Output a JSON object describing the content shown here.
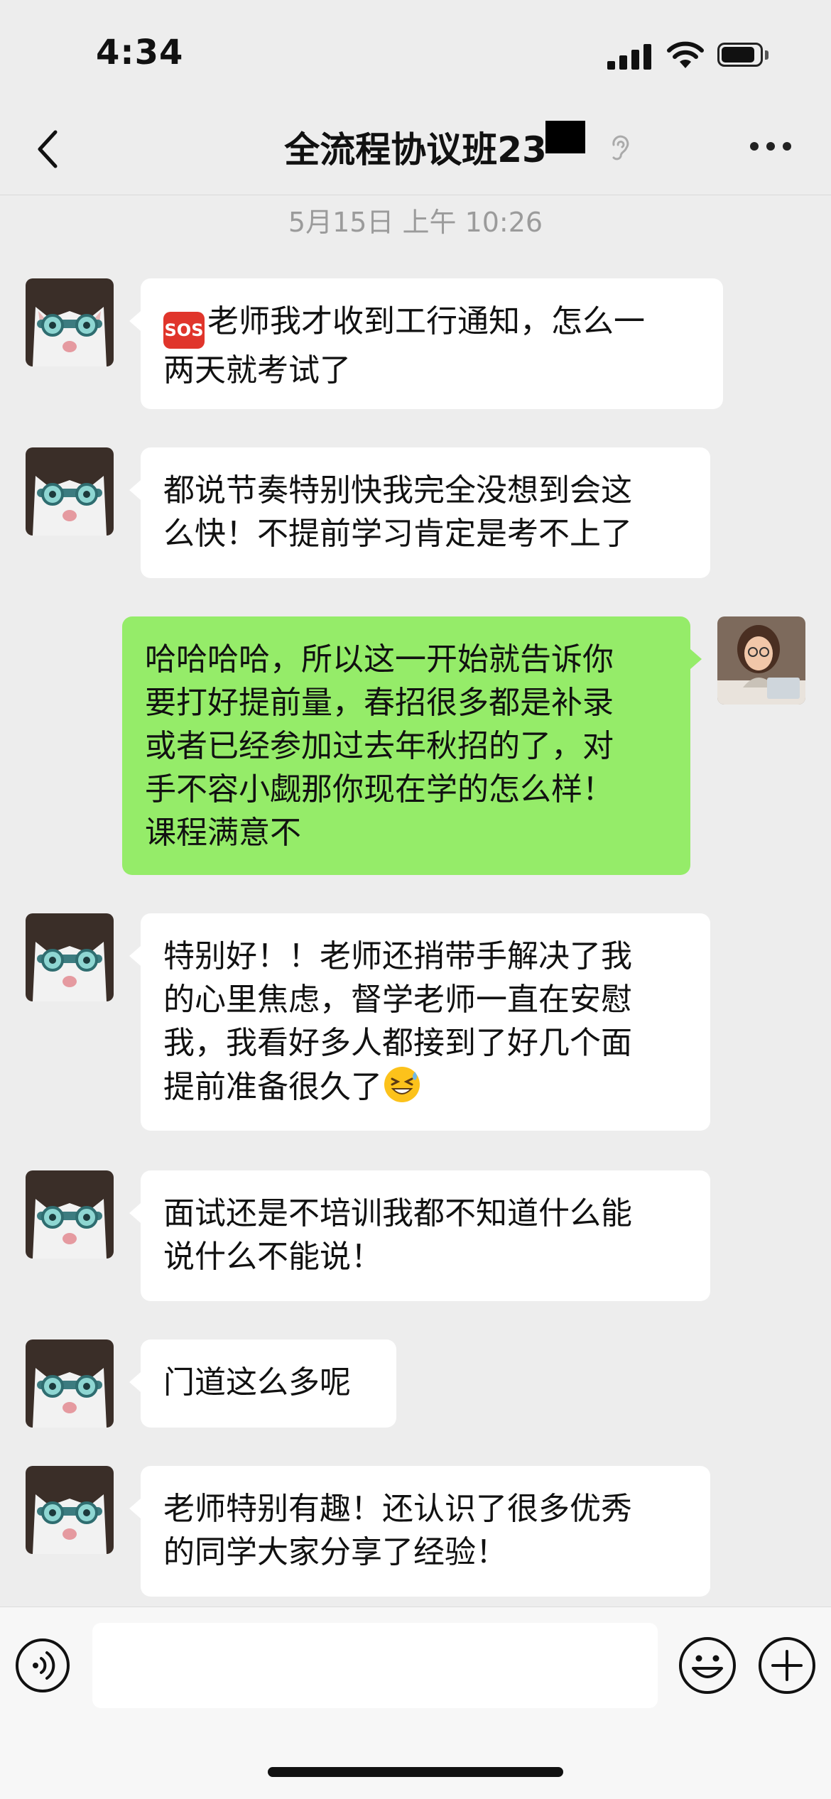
{
  "status_bar": {
    "time": "4:34",
    "icons": [
      "signal-icon",
      "wifi-icon",
      "battery-icon"
    ]
  },
  "nav": {
    "back_icon": "chevron-left-icon",
    "title": "全流程协议班23",
    "mute_icon": "ear-icon",
    "more_icon": "more-dots-icon"
  },
  "chat": {
    "timestamp": "5月15日 上午 10:26",
    "messages": [
      {
        "from": "other",
        "text": "老师我才收到工行通知，怎么一\n两天就考试了",
        "leading_emoji": "sos-emoji",
        "badge_text": "SOS"
      },
      {
        "from": "other",
        "text": "都说节奏特别快我完全没想到会这\n么快！不提前学习肯定是考不上了"
      },
      {
        "from": "me",
        "text": "哈哈哈哈，所以这一开始就告诉你\n要打好提前量，春招很多都是补录\n或者已经参加过去年秋招的了，对\n手不容小觑那你现在学的怎么样！\n课程满意不"
      },
      {
        "from": "other",
        "text": "特别好！！老师还捎带手解决了我\n的心里焦虑，督学老师一直在安慰\n我，我看好多人都接到了好几个面\n提前准备很久了",
        "trailing_emoji": "grinning-squint-sweat-emoji"
      },
      {
        "from": "other",
        "text": "面试还是不培训我都不知道什么能\n说什么不能说！"
      },
      {
        "from": "other",
        "text": "门道这么多呢"
      },
      {
        "from": "other",
        "text": "老师特别有趣！还认识了很多优秀\n的同学大家分享了经验！"
      }
    ]
  },
  "input_bar": {
    "voice_icon": "voice-icon",
    "input_value": "",
    "emoji_icon": "smiley-icon",
    "plus_icon": "plus-icon"
  },
  "colors": {
    "background": "#ededed",
    "incoming_bubble": "#ffffff",
    "outgoing_bubble": "#95ec69",
    "timestamp_text": "#9b9b9b"
  }
}
